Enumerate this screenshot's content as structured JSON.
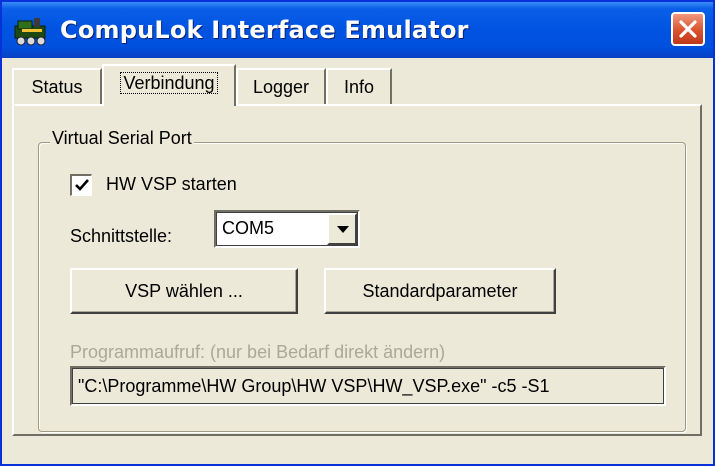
{
  "window": {
    "title": "CompuLok Interface Emulator"
  },
  "tabs": [
    {
      "label": "Status"
    },
    {
      "label": "Verbindung",
      "active": true
    },
    {
      "label": "Logger"
    },
    {
      "label": "Info"
    }
  ],
  "group": {
    "legend": "Virtual Serial Port",
    "checkbox": {
      "label": "HW VSP starten",
      "checked": true
    },
    "port": {
      "label": "Schnittstelle:",
      "value": "COM5"
    },
    "buttons": {
      "choose_vsp": "VSP wählen ...",
      "defaults": "Standardparameter"
    },
    "program": {
      "label": "Programmaufruf:  (nur bei Bedarf direkt ändern)",
      "value": "\"C:\\Programme\\HW Group\\HW VSP\\HW_VSP.exe\" -c5 -S1"
    }
  },
  "colors": {
    "titlebar": "#0053E1",
    "face": "#ECE9D8",
    "close": "#D8532E",
    "disabled_text": "#ACA899"
  },
  "icons": [
    "app-icon",
    "close-icon",
    "checkmark-icon",
    "dropdown-arrow-icon"
  ]
}
